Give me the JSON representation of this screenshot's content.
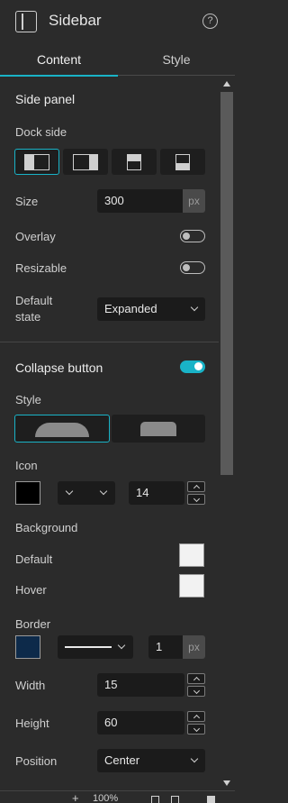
{
  "header": {
    "title": "Sidebar",
    "help_glyph": "?"
  },
  "tabs": [
    {
      "label": "Content",
      "active": true
    },
    {
      "label": "Style",
      "active": false
    }
  ],
  "side_panel": {
    "heading": "Side panel",
    "dock_side_label": "Dock side",
    "dock_options": [
      "dock-left-icon",
      "dock-right-icon",
      "dock-top-icon",
      "dock-bottom-icon"
    ],
    "dock_selected": "left",
    "size_label": "Size",
    "size_value": "300",
    "size_unit": "px",
    "overlay_label": "Overlay",
    "overlay_on": false,
    "resizable_label": "Resizable",
    "resizable_on": false,
    "default_state_label": "Default state",
    "default_state_value": "Expanded"
  },
  "collapse_button": {
    "heading": "Collapse button",
    "enabled": true,
    "style_label": "Style",
    "style_options": [
      "rounded-tab-icon",
      "flat-tab-icon"
    ],
    "style_selected": "rounded",
    "icon_label": "Icon",
    "icon_color": "#000000",
    "icon_size": "14",
    "background_label": "Background",
    "default_label": "Default",
    "default_color": "#f2f2f2",
    "hover_label": "Hover",
    "hover_color": "#f2f2f2",
    "border_label": "Border",
    "border_color": "#0d2a4a",
    "border_width": "1",
    "border_unit": "px",
    "width_label": "Width",
    "width_value": "15",
    "height_label": "Height",
    "height_value": "60",
    "position_label": "Position",
    "position_value": "Center"
  },
  "footer": {
    "zoom": "100%"
  },
  "colors": {
    "accent": "#19b3c7",
    "background": "#2b2b2b",
    "field": "#1b1b1b"
  }
}
